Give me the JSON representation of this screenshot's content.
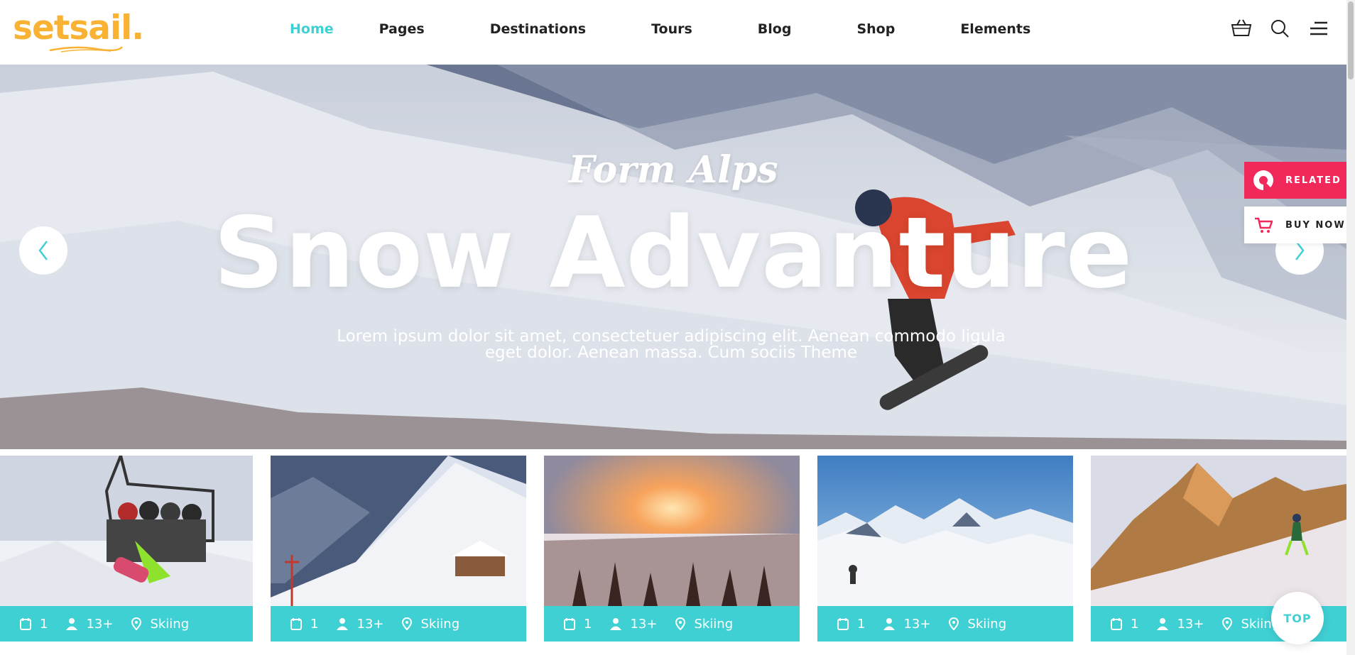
{
  "logo": {
    "text": "setsail."
  },
  "nav": {
    "items": [
      {
        "label": "Home",
        "active": true
      },
      {
        "label": "Pages"
      },
      {
        "label": "Destinations"
      },
      {
        "label": "Tours"
      },
      {
        "label": "Blog"
      },
      {
        "label": "Shop"
      },
      {
        "label": "Elements"
      }
    ]
  },
  "header_icons": [
    "basket-icon",
    "search-icon",
    "menu-icon"
  ],
  "hero": {
    "script": "Form Alps",
    "title": "Snow Advanture",
    "subtitle_line1": "Lorem ipsum dolor sit amet, consectetuer adipiscing elit. Aenean commodo ligula",
    "subtitle_line2": "eget dolor. Aenean massa. Cum sociis Theme"
  },
  "side": {
    "related_label": "RELATED",
    "buy_label": "BUY NOW"
  },
  "cards": [
    {
      "days": "1",
      "people": "13+",
      "activity": "Skiing"
    },
    {
      "days": "1",
      "people": "13+",
      "activity": "Skiing"
    },
    {
      "days": "1",
      "people": "13+",
      "activity": "Skiing"
    },
    {
      "days": "1",
      "people": "13+",
      "activity": "Skiing"
    },
    {
      "days": "1",
      "people": "13+",
      "activity": "Skiing"
    }
  ],
  "top_button": "TOP",
  "colors": {
    "accent": "#3fd0d4",
    "logo": "#f9b233",
    "related": "#f1295a"
  }
}
